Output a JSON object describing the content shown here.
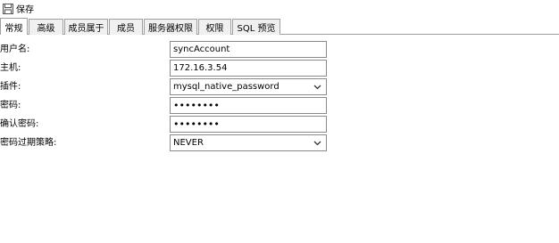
{
  "toolbar": {
    "save_label": "保存"
  },
  "tabs": [
    {
      "label": "常规",
      "active": true
    },
    {
      "label": "高级",
      "active": false
    },
    {
      "label": "成员属于",
      "active": false
    },
    {
      "label": "成员",
      "active": false
    },
    {
      "label": "服务器权限",
      "active": false
    },
    {
      "label": "权限",
      "active": false
    },
    {
      "label": "SQL 预览",
      "active": false
    }
  ],
  "form": {
    "username_label": "用户名:",
    "username_value": "syncAccount",
    "host_label": "主机:",
    "host_value": "172.16.3.54",
    "plugin_label": "插件:",
    "plugin_value": "mysql_native_password",
    "password_label": "密码:",
    "password_mask": "••••••••",
    "confirm_label": "确认密码:",
    "confirm_mask": "••••••••",
    "expire_label": "密码过期策略:",
    "expire_value": "NEVER"
  },
  "icons": {
    "save": "save-icon",
    "dropdown": "chevron-down-icon"
  }
}
